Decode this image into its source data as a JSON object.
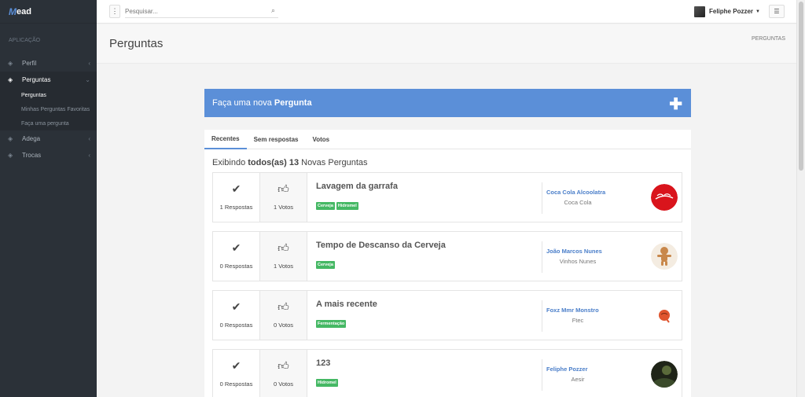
{
  "app": {
    "logo_m": "M",
    "logo_rest": "ead"
  },
  "sidebar": {
    "section": "APLICAÇÃO",
    "items": [
      {
        "label": "Perfil",
        "icon": "layers-icon"
      },
      {
        "label": "Perguntas",
        "icon": "layers-icon"
      },
      {
        "label": "Adega",
        "icon": "layers-icon"
      },
      {
        "label": "Trocas",
        "icon": "layers-icon"
      }
    ],
    "subitems": [
      {
        "label": "Perguntas"
      },
      {
        "label": "Minhas Perguntas Favoritas"
      },
      {
        "label": "Faça uma pergunta"
      }
    ]
  },
  "topbar": {
    "search_placeholder": "Pesquisar...",
    "user_name": "Feliphe Pozzer"
  },
  "page": {
    "title": "Perguntas",
    "breadcrumb": "PERGUNTAS"
  },
  "banner": {
    "prefix": "Faça uma nova ",
    "strong": "Pergunta"
  },
  "tabs": [
    {
      "label": "Recentes"
    },
    {
      "label": "Sem respostas"
    },
    {
      "label": "Votos"
    }
  ],
  "showing": {
    "a": "Exibindo ",
    "b": "todos(as) 13",
    "c": " Novas Perguntas"
  },
  "questions": [
    {
      "answers": "1 Respostas",
      "votes": "1 Votos",
      "title": "Lavagem da garrafa",
      "tags": [
        "Cerveja",
        "Hidromel"
      ],
      "author": "Coca Cola Alcoolatra",
      "subtitle": "Coca Cola"
    },
    {
      "answers": "0 Respostas",
      "votes": "1 Votos",
      "title": "Tempo de Descanso da Cerveja",
      "tags": [
        "Cerveja"
      ],
      "author": "João Marcos Nunes",
      "subtitle": "Vinhos Nunes"
    },
    {
      "answers": "0 Respostas",
      "votes": "0 Votos",
      "title": "A mais recente",
      "tags": [
        "Fermentação"
      ],
      "author": "Foxz Mmr Monstro",
      "subtitle": "Ftec"
    },
    {
      "answers": "0 Respostas",
      "votes": "0 Votos",
      "title": "123",
      "tags": [
        "Hidromel"
      ],
      "author": "Feliphe Pozzer",
      "subtitle": "Aesir"
    }
  ],
  "colors": {
    "accent": "#5b8fd8",
    "tag": "#45b864",
    "sidebar": "#2b3138"
  }
}
